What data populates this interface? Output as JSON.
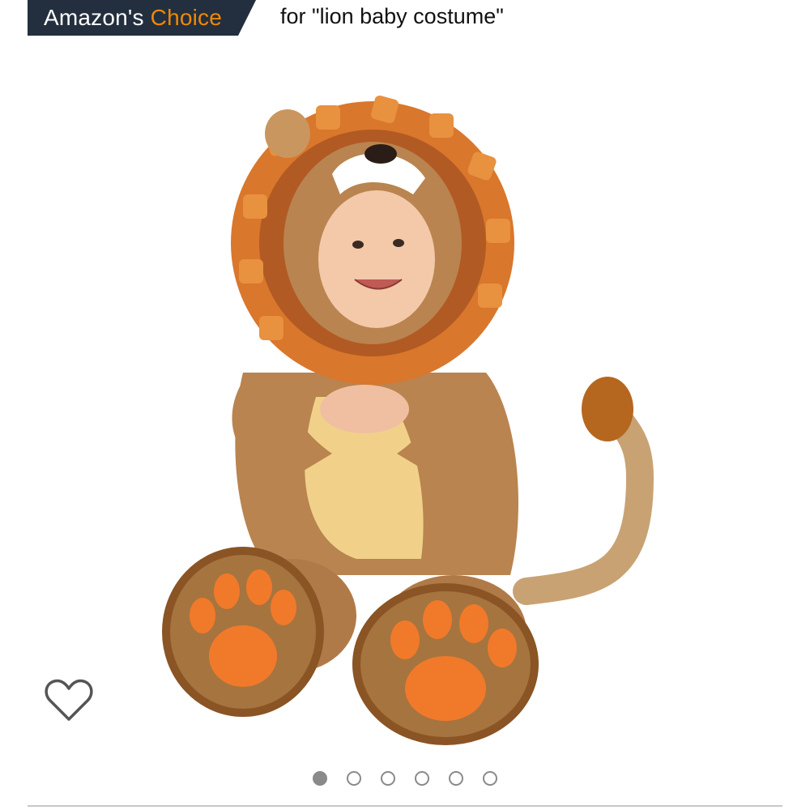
{
  "badge": {
    "prefix": "Amazon's",
    "highlight": "Choice",
    "query_text": "for \"lion baby costume\""
  },
  "colors": {
    "badge_bg": "#232f3e",
    "badge_text": "#ffffff",
    "badge_highlight": "#f08804"
  },
  "product_image": {
    "subject": "baby in lion costume"
  },
  "wishlist": {
    "icon": "heart-outline-icon"
  },
  "carousel": {
    "total": 6,
    "active_index": 0
  }
}
